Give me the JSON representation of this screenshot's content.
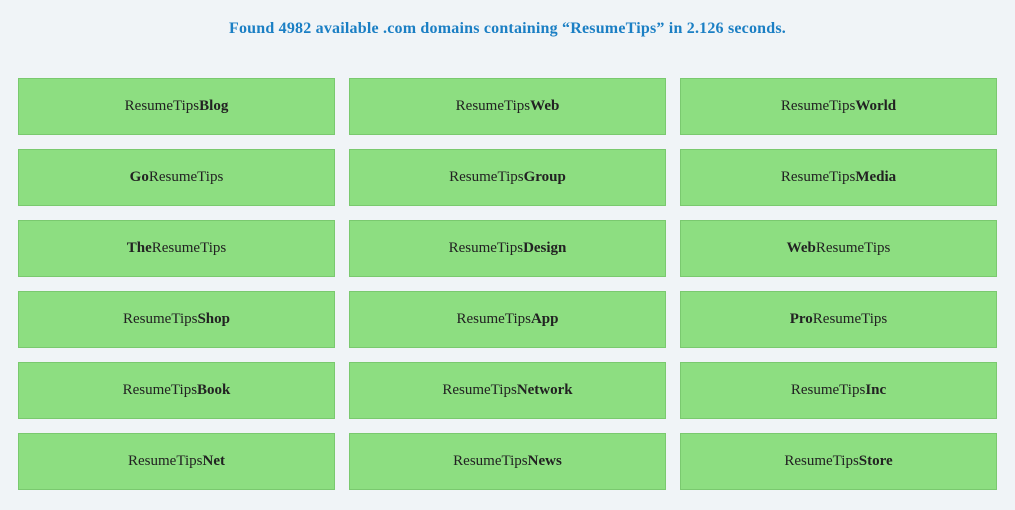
{
  "heading": "Found 4982 available .com domains containing “ResumeTips” in 2.126 seconds.",
  "domains": [
    {
      "prefix": "",
      "base": "ResumeTips",
      "suffix": "Blog"
    },
    {
      "prefix": "",
      "base": "ResumeTips",
      "suffix": "Web"
    },
    {
      "prefix": "",
      "base": "ResumeTips",
      "suffix": "World"
    },
    {
      "prefix": "Go",
      "base": "ResumeTips",
      "suffix": ""
    },
    {
      "prefix": "",
      "base": "ResumeTips",
      "suffix": "Group"
    },
    {
      "prefix": "",
      "base": "ResumeTips",
      "suffix": "Media"
    },
    {
      "prefix": "The",
      "base": "ResumeTips",
      "suffix": ""
    },
    {
      "prefix": "",
      "base": "ResumeTips",
      "suffix": "Design"
    },
    {
      "prefix": "Web",
      "base": "ResumeTips",
      "suffix": ""
    },
    {
      "prefix": "",
      "base": "ResumeTips",
      "suffix": "Shop"
    },
    {
      "prefix": "",
      "base": "ResumeTips",
      "suffix": "App"
    },
    {
      "prefix": "Pro",
      "base": "ResumeTips",
      "suffix": ""
    },
    {
      "prefix": "",
      "base": "ResumeTips",
      "suffix": "Book"
    },
    {
      "prefix": "",
      "base": "ResumeTips",
      "suffix": "Network"
    },
    {
      "prefix": "",
      "base": "ResumeTips",
      "suffix": "Inc"
    },
    {
      "prefix": "",
      "base": "ResumeTips",
      "suffix": "Net"
    },
    {
      "prefix": "",
      "base": "ResumeTips",
      "suffix": "News"
    },
    {
      "prefix": "",
      "base": "ResumeTips",
      "suffix": "Store"
    }
  ]
}
